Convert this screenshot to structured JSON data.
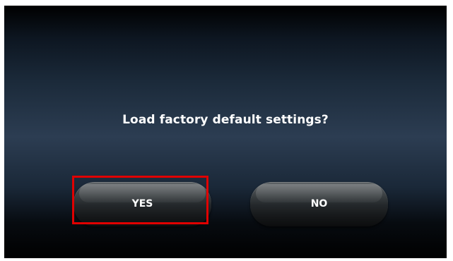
{
  "dialog": {
    "message": "Load factory default settings?",
    "yes_label": "YES",
    "no_label": "NO"
  },
  "colors": {
    "highlight": "#e00000",
    "text": "#ffffff"
  }
}
